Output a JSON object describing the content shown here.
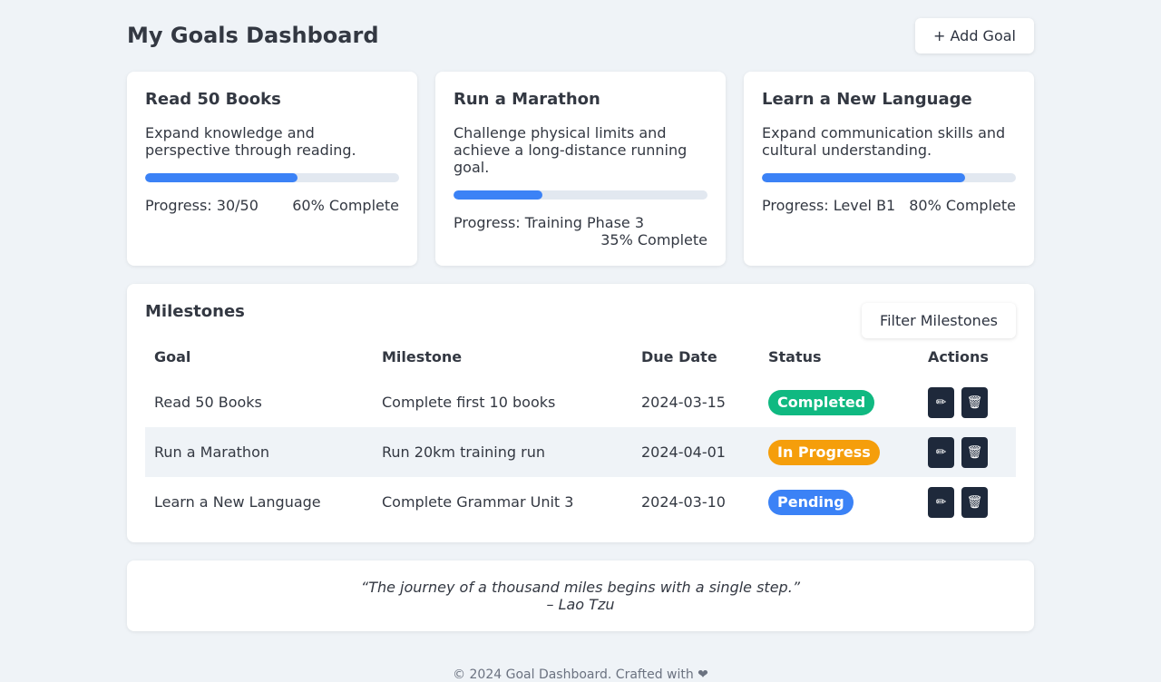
{
  "header": {
    "title": "My Goals Dashboard",
    "add_goal_label": "+ Add Goal"
  },
  "goals": [
    {
      "title": "Read 50 Books",
      "description": "Expand knowledge and perspective through reading.",
      "progress_text": "Progress: 30/50",
      "percent_text": "60% Complete",
      "percent": 60
    },
    {
      "title": "Run a Marathon",
      "description": "Challenge physical limits and achieve a long-distance running goal.",
      "progress_text": "Progress: Training Phase 3",
      "percent_text": "35% Complete",
      "percent": 35
    },
    {
      "title": "Learn a New Language",
      "description": "Expand communication skills and cultural understanding.",
      "progress_text": "Progress: Level B1",
      "percent_text": "80% Complete",
      "percent": 80
    }
  ],
  "milestones": {
    "title": "Milestones",
    "filter_label": "Filter Milestones",
    "columns": [
      "Goal",
      "Milestone",
      "Due Date",
      "Status",
      "Actions"
    ],
    "rows": [
      {
        "goal": "Read 50 Books",
        "milestone": "Complete first 10 books",
        "due": "2024-03-15",
        "status": "Completed",
        "status_color": "#10b981"
      },
      {
        "goal": "Run a Marathon",
        "milestone": "Run 20km training run",
        "due": "2024-04-01",
        "status": "In Progress",
        "status_color": "#f59e0b"
      },
      {
        "goal": "Learn a New Language",
        "milestone": "Complete Grammar Unit 3",
        "due": "2024-03-10",
        "status": "Pending",
        "status_color": "#3b82f6"
      }
    ],
    "edit_icon": "✏",
    "delete_icon": "🗑"
  },
  "quote": {
    "text": "“The journey of a thousand miles begins with a single step.”",
    "author": "– Lao Tzu"
  },
  "footer": {
    "text": "© 2024 Goal Dashboard. Crafted with ❤"
  },
  "colors": {
    "accent": "#3b82f6",
    "background": "#eff3f7",
    "action_button": "#1e293b"
  }
}
